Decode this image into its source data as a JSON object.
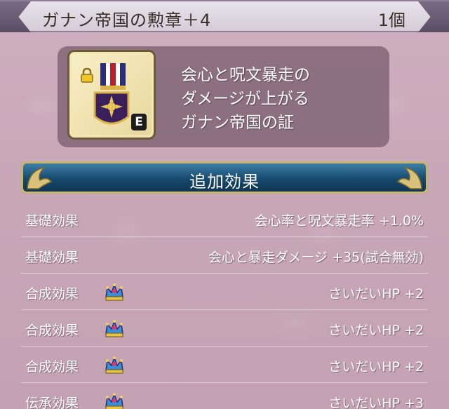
{
  "header": {
    "title": "ガナン帝国の勲章＋4",
    "count": "1個"
  },
  "item": {
    "equipped_badge": "E",
    "description": [
      "会心と呪文暴走の",
      "ダメージが上がる",
      "ガナン帝国の証"
    ]
  },
  "section": {
    "title": "追加効果"
  },
  "effects": [
    {
      "category": "基礎効果",
      "value": "会心率と呪文暴走率 +1.0%",
      "crown": false
    },
    {
      "category": "基礎効果",
      "value": "会心と暴走ダメージ +35(試合無効)",
      "crown": false
    },
    {
      "category": "合成効果",
      "value": "さいだいHP +2",
      "crown": true
    },
    {
      "category": "合成効果",
      "value": "さいだいHP +2",
      "crown": true
    },
    {
      "category": "合成効果",
      "value": "さいだいHP +2",
      "crown": true
    },
    {
      "category": "伝承効果",
      "value": "さいだいHP +3",
      "crown": true
    }
  ],
  "icons": {
    "lock": "lock-icon",
    "medal": "medal-icon",
    "crown": "crown-icon"
  },
  "colors": {
    "background": "#c9a9b8",
    "banner": "#174a6e",
    "banner_border": "#c9b46a"
  }
}
